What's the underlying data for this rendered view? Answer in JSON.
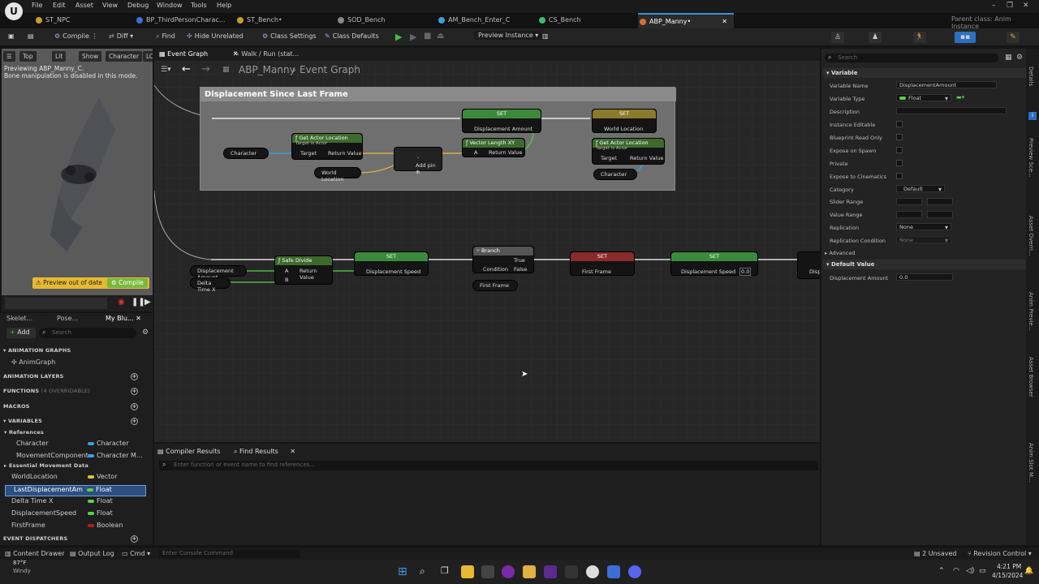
{
  "menu": {
    "items": [
      "File",
      "Edit",
      "Asset",
      "View",
      "Debug",
      "Window",
      "Tools",
      "Help"
    ],
    "logo": "U"
  },
  "parent_class": "Parent class: Anim Instance",
  "tabs": [
    {
      "label": "ST_NPC",
      "color": "#c8a020"
    },
    {
      "label": "BP_ThirdPersonCharac...",
      "color": "#3a6fd8"
    },
    {
      "label": "ST_Bench•",
      "color": "#c8a020"
    },
    {
      "label": "SOD_Bench",
      "color": "#888888"
    },
    {
      "label": "AM_Bench_Enter_C",
      "color": "#3aa0d8"
    },
    {
      "label": "CS_Bench",
      "color": "#3ac070"
    },
    {
      "label": "ABP_Manny•",
      "color": "#d07030"
    }
  ],
  "toolbar": {
    "compile": "Compile",
    "diff": "Diff",
    "find": "Find",
    "hide_unrelated": "Hide Unrelated",
    "class_settings": "Class Settings",
    "class_defaults": "Class Defaults",
    "preview_instance": "Preview Instance"
  },
  "viewport": {
    "buttons": [
      "Top",
      "Lit",
      "Show",
      "Character",
      "LO"
    ],
    "msg1": "Previewing ABP_Manny_C.",
    "msg2": "Bone manipulation is disabled in this mode.",
    "preview_out_of_date": "Preview out of date",
    "compile": "Compile"
  },
  "left_tabs": [
    "Skelet...",
    "Pose...",
    "My Blu..."
  ],
  "left": {
    "add": "Add",
    "search_placeholder": "Search",
    "animation_graphs": "ANIMATION GRAPHS",
    "anim_graph": "AnimGraph",
    "animation_layers": "ANIMATION LAYERS",
    "functions": "FUNCTIONS",
    "functions_note": "(4 OVERRIDABLE)",
    "macros": "MACROS",
    "variables": "VARIABLES",
    "references": "References",
    "essential": "Essential Movement Data",
    "event_dispatchers": "EVENT DISPATCHERS",
    "vars": [
      {
        "name": "Character",
        "type": "Character",
        "color": "#3aa0e0"
      },
      {
        "name": "MovementComponent",
        "type": "Character M...",
        "color": "#3aa0e0"
      },
      {
        "name": "WorldLocation",
        "type": "Vector",
        "color": "#e0c030"
      },
      {
        "name": "LastDisplacementAm",
        "type": "Float",
        "color": "#5ad04a"
      },
      {
        "name": "Delta Time X",
        "type": "Float",
        "color": "#5ad04a"
      },
      {
        "name": "DisplacementSpeed",
        "type": "Float",
        "color": "#5ad04a"
      },
      {
        "name": "FirstFrame",
        "type": "Boolean",
        "color": "#b02020"
      }
    ]
  },
  "graph_tabs": {
    "event_graph": "Event Graph",
    "walk_run": "Walk / Run (stat..."
  },
  "graph": {
    "breadcrumb_bp": "ABP_Manny",
    "breadcrumb_graph": "Event Graph",
    "comment": "Displacement Since Last Frame",
    "n_character": "Character",
    "n_get_actor_loc": "Get Actor Location",
    "n_target_actor": "Target is Actor",
    "target": "Target",
    "return_value": "Return Value",
    "n_world_location": "World Location",
    "add_pin": "Add pin",
    "set": "SET",
    "displacement_amount": "Displacement Amount",
    "vector_length": "Vector Length XY",
    "pin_a": "A",
    "safe_divide": "Safe Divide",
    "pin_b": "B",
    "delta_time": "Delta Time X",
    "displacement_speed": "Displacement Speed",
    "branch": "Branch",
    "condition": "Condition",
    "true": "True",
    "false": "False",
    "first_frame": "First Frame",
    "zero": "0.0",
    "displ": "Displ..."
  },
  "bottom": {
    "compiler_results": "Compiler Results",
    "find_results": "Find Results",
    "find_placeholder": "Enter function or event name to find references..."
  },
  "details": {
    "search_placeholder": "Search",
    "variable_section": "Variable",
    "rows": [
      {
        "label": "Variable Name",
        "value": "DisplacementAmount"
      },
      {
        "label": "Variable Type",
        "value": "Float"
      },
      {
        "label": "Description",
        "value": ""
      },
      {
        "label": "Instance Editable",
        "value": ""
      },
      {
        "label": "Blueprint Read Only",
        "value": ""
      },
      {
        "label": "Expose on Spawn",
        "value": ""
      },
      {
        "label": "Private",
        "value": ""
      },
      {
        "label": "Expose to Cinematics",
        "value": ""
      },
      {
        "label": "Category",
        "value": "Default"
      },
      {
        "label": "Slider Range",
        "value": ""
      },
      {
        "label": "Value Range",
        "value": ""
      },
      {
        "label": "Replication",
        "value": "None"
      },
      {
        "label": "Replication Condition",
        "value": "None"
      }
    ],
    "advanced": "Advanced",
    "default_value": "Default Value",
    "default_row": {
      "label": "Displacement Amount",
      "value": "0.0"
    }
  },
  "right_strip": [
    "Details",
    "Preview Sce...",
    "Asset Overri...",
    "Anim Previe...",
    "Asset Browser",
    "Anim Slot M..."
  ],
  "status": {
    "content_drawer": "Content Drawer",
    "output_log": "Output Log",
    "cmd": "Cmd",
    "console_placeholder": "Enter Console Command",
    "unsaved": "2 Unsaved",
    "revision": "Revision Control"
  },
  "taskbar": {
    "temp": "87°F",
    "weather": "Windy",
    "time": "4:21 PM",
    "date": "4/15/2024"
  }
}
